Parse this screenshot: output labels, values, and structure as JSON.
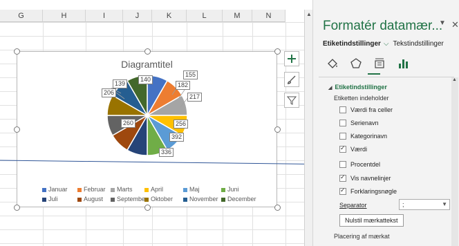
{
  "sheet": {
    "columns": [
      "G",
      "H",
      "I",
      "J",
      "K",
      "L",
      "M",
      "N"
    ]
  },
  "chart": {
    "title": "Diagramtitel",
    "data_labels": [
      "139",
      "140",
      "155",
      "206",
      "182",
      "217",
      "256",
      "260",
      "392",
      "336"
    ],
    "legend_row1": [
      "Januar",
      "Februar",
      "Marts",
      "April",
      "Maj",
      "Juni"
    ],
    "legend_row2": [
      "Juli",
      "August",
      "September",
      "Oktober",
      "November",
      "December"
    ]
  },
  "chart_data": {
    "type": "pie",
    "title": "Diagramtitel",
    "categories": [
      "Januar",
      "Februar",
      "Marts",
      "April",
      "Maj",
      "Juni",
      "Juli",
      "August",
      "September",
      "Oktober",
      "November",
      "December"
    ],
    "values": [
      155,
      182,
      217,
      256,
      392,
      336,
      null,
      null,
      260,
      206,
      139,
      140
    ],
    "colors": [
      "#4472c4",
      "#ed7d31",
      "#a5a5a5",
      "#ffc000",
      "#5b9bd5",
      "#70ad47",
      "#264478",
      "#9e480e",
      "#636363",
      "#997300",
      "#255e91",
      "#43682b"
    ],
    "legend": "bottom"
  },
  "pane": {
    "title": "Formatér datamær...",
    "tab_active": "Etiketindstillinger",
    "tab_other": "Tekstindstillinger",
    "section": "Etiketindstillinger",
    "subheader": "Etiketten indeholder",
    "options": [
      {
        "label": "Værdi fra celler",
        "checked": false
      },
      {
        "label": "Serienavn",
        "checked": false
      },
      {
        "label": "Kategorinavn",
        "checked": false
      },
      {
        "label": "Værdi",
        "checked": true
      },
      {
        "label": "Procentdel",
        "checked": false
      },
      {
        "label": "Vis navnelinjer",
        "checked": true
      },
      {
        "label": "Forklaringsnøgle",
        "checked": true
      }
    ],
    "separator_label": "Separator",
    "separator_value": ";",
    "reset_label": "Nulstil mærkattekst",
    "placement_label": "Placering af mærkat",
    "accent_color": "#217346"
  }
}
